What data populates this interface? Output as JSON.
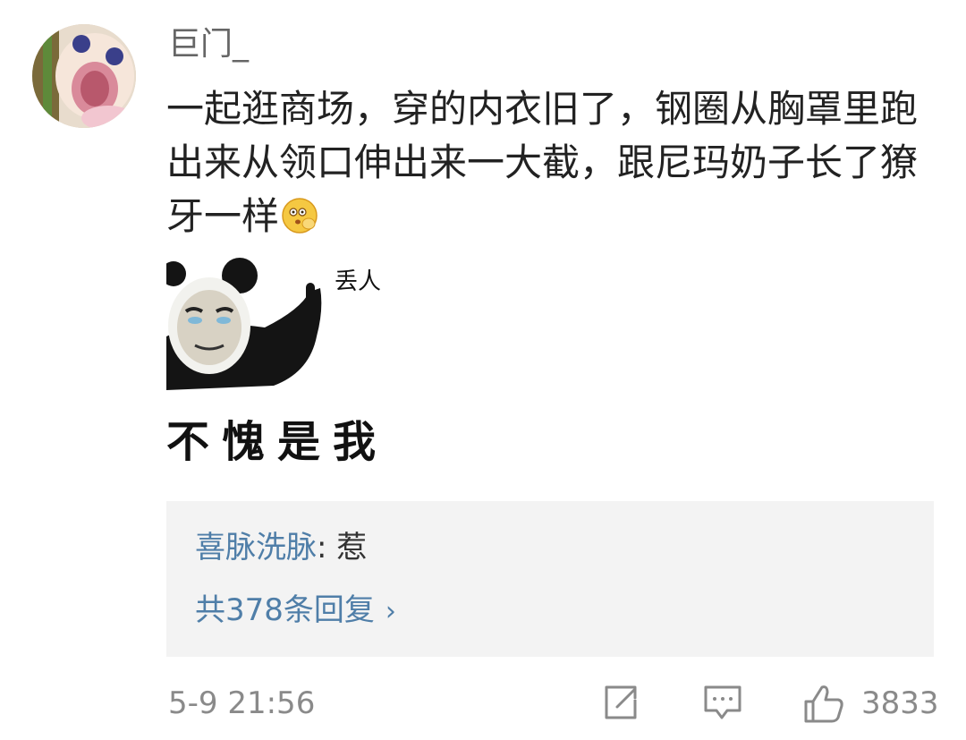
{
  "comment": {
    "username": "巨门_",
    "content": "一起逛商场，穿的内衣旧了，钢圈从胸罩里跑出来从领口伸出来一大截，跟尼玛奶子长了獠牙一样",
    "inline_emoji": "shy-face-emoji",
    "sticker": {
      "label": "丢人",
      "caption": "不愧是我"
    },
    "reply_preview": {
      "author": "喜脉洗脉",
      "separator": ":",
      "text": "惹",
      "more_label": "共378条回复",
      "chevron": "›"
    },
    "timestamp": "5-9 21:56",
    "actions": {
      "share_icon": "share-icon",
      "reply_icon": "comment-icon",
      "like_icon": "thumbs-up-icon",
      "like_count": "3833"
    }
  },
  "colors": {
    "link": "#4f7ea8",
    "meta": "#8a8a8a",
    "text": "#222222",
    "reply_bg": "#f3f3f3"
  }
}
